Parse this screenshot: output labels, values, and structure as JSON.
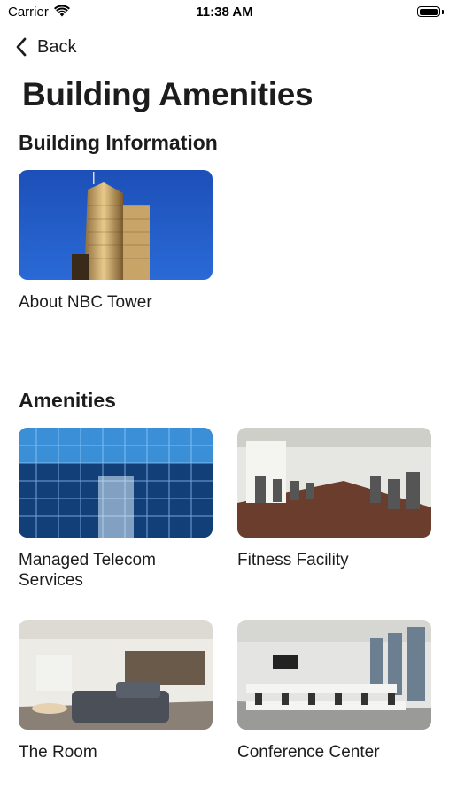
{
  "status": {
    "carrier": "Carrier",
    "time": "11:38 AM"
  },
  "nav": {
    "back_label": "Back"
  },
  "page": {
    "title": "Building Amenities"
  },
  "sections": {
    "building_info": {
      "title": "Building Information",
      "items": [
        {
          "label": "About NBC Tower",
          "image": "nbc-tower-photo"
        }
      ]
    },
    "amenities": {
      "title": "Amenities",
      "items": [
        {
          "label": "Managed Telecom Services",
          "image": "server-room-photo"
        },
        {
          "label": "Fitness Facility",
          "image": "gym-photo"
        },
        {
          "label": "The Room",
          "image": "lounge-photo"
        },
        {
          "label": "Conference Center",
          "image": "conference-room-photo"
        }
      ]
    }
  }
}
